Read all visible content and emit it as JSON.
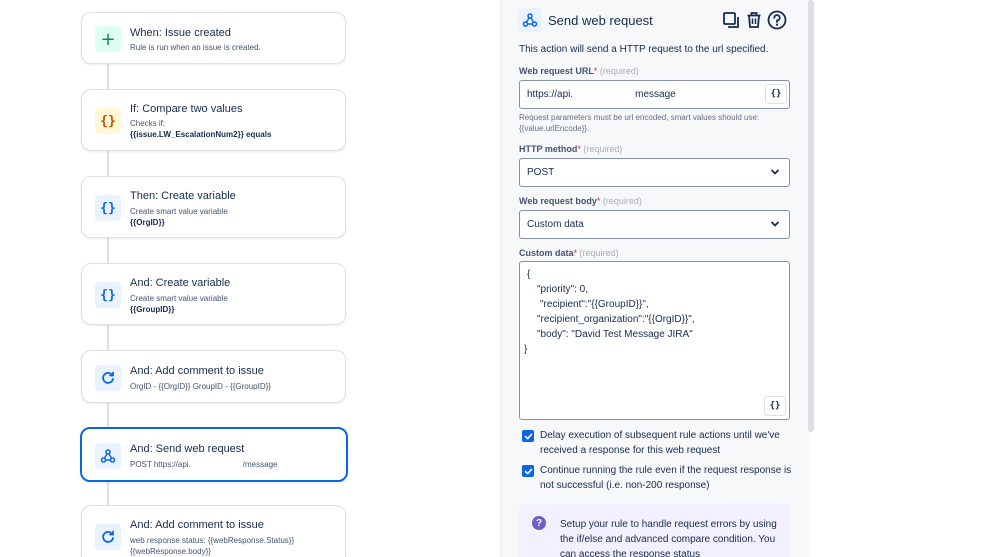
{
  "rules": [
    {
      "kind": "trigger",
      "icon": "plus-icon",
      "glyph": "+",
      "title": "When: Issue created",
      "sub1": "Rule is run when an issue is created.",
      "sub2": ""
    },
    {
      "kind": "condition",
      "icon": "braces-icon",
      "glyph": "{}",
      "title": "If: Compare two values",
      "sub1": "Checks if:",
      "sub2": "{{issue.LW_EscalationNum2}} equals"
    },
    {
      "kind": "action",
      "icon": "braces-icon",
      "glyph": "{}",
      "title": "Then: Create variable",
      "sub1": "Create smart value variable",
      "sub2": "{{OrgID}}"
    },
    {
      "kind": "action",
      "icon": "braces-icon",
      "glyph": "{}",
      "title": "And: Create variable",
      "sub1": "Create smart value variable",
      "sub2": "{{GroupID}}"
    },
    {
      "kind": "action",
      "icon": "refresh-icon",
      "glyph": "",
      "title": "And: Add comment to issue",
      "sub1": "OrgID - {{OrgID}} GroupID - {{GroupID}}",
      "sub2": ""
    },
    {
      "kind": "action",
      "icon": "webhook-icon",
      "glyph": "",
      "title": "And: Send web request",
      "sub1_a": "POST https://api.",
      "sub1_b": "/message",
      "sub2": ""
    },
    {
      "kind": "action",
      "icon": "refresh-icon",
      "glyph": "",
      "title": "And: Add comment to issue",
      "sub1": "web response status: {{webResponse.Status}}",
      "sub2": "{{webResponse.body}}"
    }
  ],
  "panel": {
    "title": "Send web request",
    "description": "This action will send a HTTP request to the url specified.",
    "url_label": "Web request URL",
    "required_mark": "*",
    "required_text": "(required)",
    "url_value_a": "https://api.",
    "url_value_b": "message",
    "url_help": "Request parameters must be url encoded, smart values should use: {{value.urlEncode}}.",
    "method_label": "HTTP method",
    "method_value": "POST",
    "body_label": "Web request body",
    "body_value": "Custom data",
    "custom_label": "Custom data",
    "custom_lines": [
      "{",
      "\"priority\": 0,",
      "\"recipient\":\"{{GroupID}}\",",
      "\"recipient_organization\":\"{{OrgID}}\",",
      "\"body\": \"David Test Message JIRA\"",
      "}"
    ],
    "smart_value_button": "{}",
    "delay_label": "Delay execution of subsequent rule actions until we've received a response for this web request",
    "continue_label": "Continue running the rule even if the request response is not successful (i.e. non-200 response)",
    "info_text": "Setup your rule to handle request errors by using the if/else and advanced compare condition. You can access the response status"
  },
  "colors": {
    "accent": "#0c66e4",
    "trigger_bg": "#dcfff1",
    "condition_bg": "#fff7d6",
    "action_bg": "#e9f2ff",
    "info_bg": "#f3f0ff"
  }
}
